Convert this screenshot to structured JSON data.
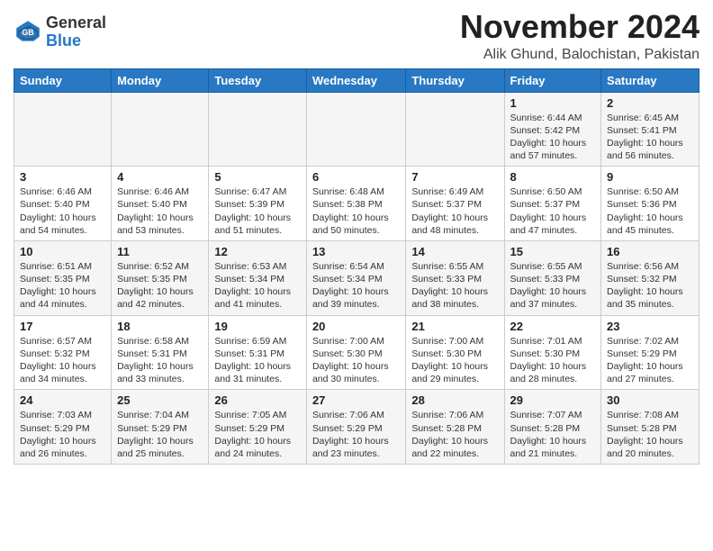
{
  "header": {
    "logo_general": "General",
    "logo_blue": "Blue",
    "month_title": "November 2024",
    "location": "Alik Ghund, Balochistan, Pakistan"
  },
  "weekdays": [
    "Sunday",
    "Monday",
    "Tuesday",
    "Wednesday",
    "Thursday",
    "Friday",
    "Saturday"
  ],
  "weeks": [
    [
      {
        "day": "",
        "info": ""
      },
      {
        "day": "",
        "info": ""
      },
      {
        "day": "",
        "info": ""
      },
      {
        "day": "",
        "info": ""
      },
      {
        "day": "",
        "info": ""
      },
      {
        "day": "1",
        "info": "Sunrise: 6:44 AM\nSunset: 5:42 PM\nDaylight: 10 hours and 57 minutes."
      },
      {
        "day": "2",
        "info": "Sunrise: 6:45 AM\nSunset: 5:41 PM\nDaylight: 10 hours and 56 minutes."
      }
    ],
    [
      {
        "day": "3",
        "info": "Sunrise: 6:46 AM\nSunset: 5:40 PM\nDaylight: 10 hours and 54 minutes."
      },
      {
        "day": "4",
        "info": "Sunrise: 6:46 AM\nSunset: 5:40 PM\nDaylight: 10 hours and 53 minutes."
      },
      {
        "day": "5",
        "info": "Sunrise: 6:47 AM\nSunset: 5:39 PM\nDaylight: 10 hours and 51 minutes."
      },
      {
        "day": "6",
        "info": "Sunrise: 6:48 AM\nSunset: 5:38 PM\nDaylight: 10 hours and 50 minutes."
      },
      {
        "day": "7",
        "info": "Sunrise: 6:49 AM\nSunset: 5:37 PM\nDaylight: 10 hours and 48 minutes."
      },
      {
        "day": "8",
        "info": "Sunrise: 6:50 AM\nSunset: 5:37 PM\nDaylight: 10 hours and 47 minutes."
      },
      {
        "day": "9",
        "info": "Sunrise: 6:50 AM\nSunset: 5:36 PM\nDaylight: 10 hours and 45 minutes."
      }
    ],
    [
      {
        "day": "10",
        "info": "Sunrise: 6:51 AM\nSunset: 5:35 PM\nDaylight: 10 hours and 44 minutes."
      },
      {
        "day": "11",
        "info": "Sunrise: 6:52 AM\nSunset: 5:35 PM\nDaylight: 10 hours and 42 minutes."
      },
      {
        "day": "12",
        "info": "Sunrise: 6:53 AM\nSunset: 5:34 PM\nDaylight: 10 hours and 41 minutes."
      },
      {
        "day": "13",
        "info": "Sunrise: 6:54 AM\nSunset: 5:34 PM\nDaylight: 10 hours and 39 minutes."
      },
      {
        "day": "14",
        "info": "Sunrise: 6:55 AM\nSunset: 5:33 PM\nDaylight: 10 hours and 38 minutes."
      },
      {
        "day": "15",
        "info": "Sunrise: 6:55 AM\nSunset: 5:33 PM\nDaylight: 10 hours and 37 minutes."
      },
      {
        "day": "16",
        "info": "Sunrise: 6:56 AM\nSunset: 5:32 PM\nDaylight: 10 hours and 35 minutes."
      }
    ],
    [
      {
        "day": "17",
        "info": "Sunrise: 6:57 AM\nSunset: 5:32 PM\nDaylight: 10 hours and 34 minutes."
      },
      {
        "day": "18",
        "info": "Sunrise: 6:58 AM\nSunset: 5:31 PM\nDaylight: 10 hours and 33 minutes."
      },
      {
        "day": "19",
        "info": "Sunrise: 6:59 AM\nSunset: 5:31 PM\nDaylight: 10 hours and 31 minutes."
      },
      {
        "day": "20",
        "info": "Sunrise: 7:00 AM\nSunset: 5:30 PM\nDaylight: 10 hours and 30 minutes."
      },
      {
        "day": "21",
        "info": "Sunrise: 7:00 AM\nSunset: 5:30 PM\nDaylight: 10 hours and 29 minutes."
      },
      {
        "day": "22",
        "info": "Sunrise: 7:01 AM\nSunset: 5:30 PM\nDaylight: 10 hours and 28 minutes."
      },
      {
        "day": "23",
        "info": "Sunrise: 7:02 AM\nSunset: 5:29 PM\nDaylight: 10 hours and 27 minutes."
      }
    ],
    [
      {
        "day": "24",
        "info": "Sunrise: 7:03 AM\nSunset: 5:29 PM\nDaylight: 10 hours and 26 minutes."
      },
      {
        "day": "25",
        "info": "Sunrise: 7:04 AM\nSunset: 5:29 PM\nDaylight: 10 hours and 25 minutes."
      },
      {
        "day": "26",
        "info": "Sunrise: 7:05 AM\nSunset: 5:29 PM\nDaylight: 10 hours and 24 minutes."
      },
      {
        "day": "27",
        "info": "Sunrise: 7:06 AM\nSunset: 5:29 PM\nDaylight: 10 hours and 23 minutes."
      },
      {
        "day": "28",
        "info": "Sunrise: 7:06 AM\nSunset: 5:28 PM\nDaylight: 10 hours and 22 minutes."
      },
      {
        "day": "29",
        "info": "Sunrise: 7:07 AM\nSunset: 5:28 PM\nDaylight: 10 hours and 21 minutes."
      },
      {
        "day": "30",
        "info": "Sunrise: 7:08 AM\nSunset: 5:28 PM\nDaylight: 10 hours and 20 minutes."
      }
    ]
  ]
}
